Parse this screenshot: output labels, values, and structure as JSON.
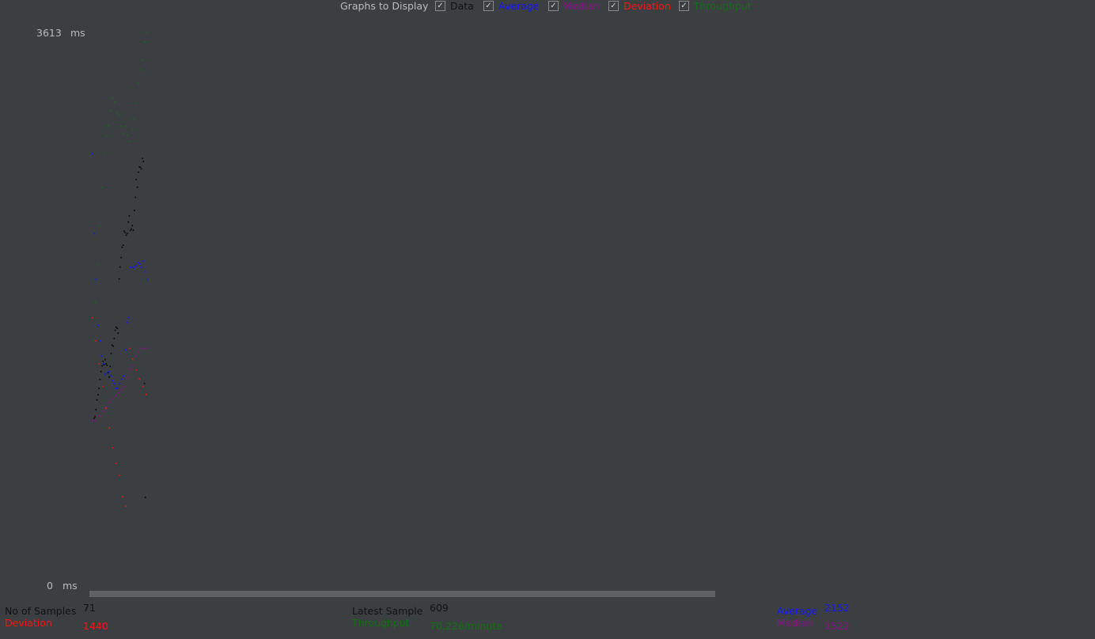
{
  "legend": {
    "title": "Graphs to Display",
    "items": [
      {
        "key": "data",
        "label": "Data",
        "checked": true,
        "color": "#000000"
      },
      {
        "key": "average",
        "label": "Average",
        "checked": true,
        "color": "#1515ff"
      },
      {
        "key": "median",
        "label": "Median",
        "checked": true,
        "color": "#8a108a"
      },
      {
        "key": "deviation",
        "label": "Deviation",
        "checked": true,
        "color": "#ff1111"
      },
      {
        "key": "throughput",
        "label": "Throughput",
        "checked": true,
        "color": "#127012"
      }
    ]
  },
  "y_axis": {
    "max_value": "3613",
    "min_value": "0",
    "unit": "ms"
  },
  "stats": {
    "samples_label": "No of Samples",
    "samples_value": "71",
    "deviation_label": "Deviation",
    "deviation_value": "1440",
    "latest_label": "Latest Sample",
    "latest_value": "609",
    "throughput_label": "Throughput",
    "throughput_value": "70,226/minute",
    "average_label": "Average",
    "average_value": "2152",
    "median_label": "Median",
    "median_value": "1522"
  },
  "chart_data": {
    "type": "scatter",
    "ylim": [
      0,
      3613
    ],
    "series": [
      {
        "name": "Data",
        "color": "#000000",
        "values": [
          1093,
          1104,
          1150,
          1214,
          1247,
          1289,
          1347,
          1398,
          1436,
          1466,
          1443,
          1477,
          1450,
          1439,
          1391,
          1364,
          1432,
          1517,
          1571,
          1565,
          1615,
          1668,
          1689,
          1680,
          1649,
          2003,
          2081,
          2143,
          2210,
          2223,
          2315,
          2304,
          2289,
          2300,
          2374,
          2414,
          2319,
          2329,
          2351,
          2322,
          2450,
          2536,
          2652,
          2602,
          2700,
          2734,
          2732,
          2722,
          2790,
          2770,
          1321,
          578
        ]
      },
      {
        "name": "Average",
        "color": "#1515ff",
        "values": [
          2820,
          2300,
          2000,
          1700,
          1600,
          1500,
          1450,
          1380,
          1390,
          1400,
          1370,
          1340,
          1320,
          1290,
          1290,
          1320,
          1350,
          1370,
          1540,
          1720,
          1750,
          2080,
          2080,
          2080,
          2090,
          2110,
          2100,
          2080,
          2120,
          2050,
          2000
        ]
      },
      {
        "name": "Median",
        "color": "#8a108a",
        "values": [
          1080,
          1080,
          1110,
          1110,
          1140,
          1170,
          1200,
          1220,
          1240,
          1260,
          1280,
          1300,
          1360,
          1420,
          1440,
          1500,
          1530,
          1550,
          1550,
          1550
        ]
      },
      {
        "name": "Deviation",
        "color": "#ff1111",
        "values": [
          1750,
          1600,
          1450,
          1300,
          1160,
          1030,
          900,
          800,
          720,
          580,
          520,
          1550,
          1480,
          1410,
          1350,
          1300,
          1250
        ]
      },
      {
        "name": "Throughput",
        "color": "#127012",
        "values": [
          1600,
          1850,
          2100,
          2350,
          2600,
          2820,
          2940,
          3000,
          3100,
          3180,
          3160,
          3090,
          3070,
          3000,
          2950,
          3000,
          2940,
          2900,
          2980,
          3050,
          3150,
          3280,
          3370,
          3430,
          3550,
          3610
        ]
      }
    ]
  }
}
